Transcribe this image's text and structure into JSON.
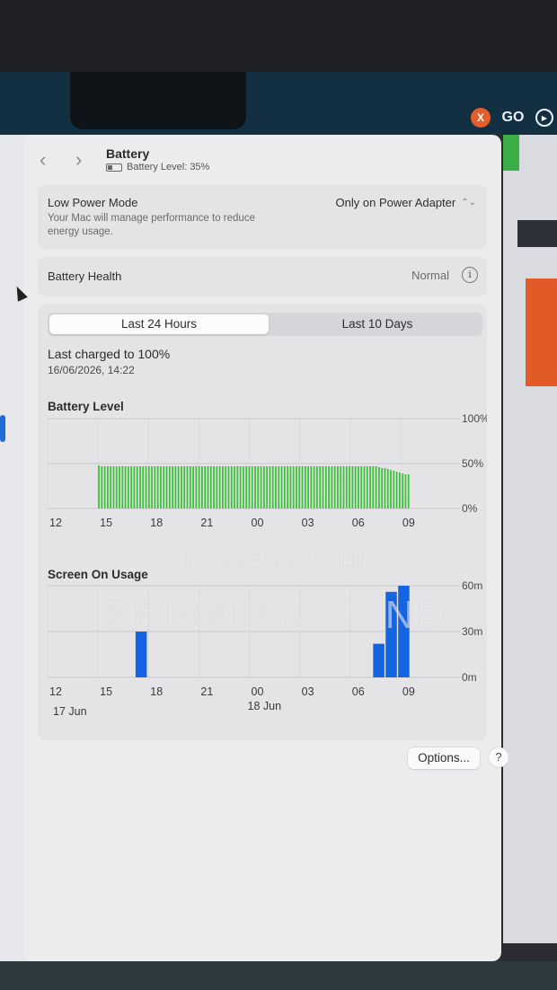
{
  "menubar": {
    "icons": [
      "x-app-icon",
      "go-icon",
      "play-circle-icon"
    ],
    "x_label": "X",
    "go_label": "GO"
  },
  "nav": {
    "back_icon": "chevron-left-icon",
    "forward_icon": "chevron-right-icon"
  },
  "header": {
    "title": "Battery",
    "battery_level": "Battery Level: 35%"
  },
  "low_power_mode": {
    "label": "Low Power Mode",
    "description": "Your Mac will manage performance to reduce energy usage.",
    "value": "Only on Power Adapter"
  },
  "battery_health": {
    "label": "Battery Health",
    "value": "Normal"
  },
  "tabs": [
    {
      "label": "Last 24 Hours",
      "active": true
    },
    {
      "label": "Last 10 Days",
      "active": false
    }
  ],
  "last_charged": {
    "title": "Last charged to 100%",
    "time": "16/06/2026, 14:22"
  },
  "chart_data": [
    {
      "type": "bar",
      "title": "Battery Level",
      "y_ticks": [
        "100%",
        "50%",
        "0%"
      ],
      "ylim": [
        0,
        100
      ],
      "x_ticks": [
        "12",
        "15",
        "18",
        "21",
        "00",
        "03",
        "06",
        "09"
      ],
      "bar_color": "#3ec13a",
      "series": [
        {
          "values": [
            48,
            47,
            47,
            47,
            47,
            47,
            47,
            47,
            47,
            47,
            47,
            47,
            47,
            47,
            47,
            47,
            47,
            47,
            47,
            47,
            47,
            47,
            47,
            47,
            47,
            47,
            47,
            47,
            47,
            47,
            47,
            47,
            47,
            47,
            47,
            47,
            47,
            47,
            47,
            47,
            47,
            47,
            47,
            47,
            47,
            47,
            47,
            47,
            47,
            47,
            47,
            47,
            47,
            47,
            47,
            47,
            47,
            47,
            47,
            47,
            47,
            47,
            47,
            47,
            47,
            47,
            47,
            47,
            47,
            47,
            47,
            47,
            47,
            47,
            47,
            47,
            47,
            47,
            47,
            47,
            47,
            47,
            47,
            47,
            47,
            47,
            47,
            47,
            47,
            47,
            47,
            47,
            47,
            47,
            47,
            46,
            45,
            45,
            44,
            43,
            42,
            41,
            40,
            39,
            38,
            38
          ]
        }
      ],
      "grid": true
    },
    {
      "type": "bar",
      "title": "Screen On Usage",
      "y_ticks": [
        "60m",
        "30m",
        "0m"
      ],
      "ylim": [
        0,
        60
      ],
      "x_ticks": [
        "12",
        "15",
        "18",
        "21",
        "00",
        "03",
        "06",
        "09"
      ],
      "date_labels": [
        "17 Jun",
        "18 Jun"
      ],
      "bar_color": "#1565e0",
      "series": [
        {
          "values": [
            0,
            0,
            0,
            30,
            0,
            0,
            0,
            0,
            0,
            0,
            0,
            0,
            0,
            0,
            0,
            0,
            0,
            0,
            0,
            0,
            0,
            0,
            22,
            56,
            60
          ]
        }
      ],
      "grid": true
    }
  ],
  "footer": {
    "options_label": "Options...",
    "help_label": "?"
  },
  "watermarks": [
    "POSTED ON JIJI",
    "BRIANNYAKUNDI"
  ]
}
